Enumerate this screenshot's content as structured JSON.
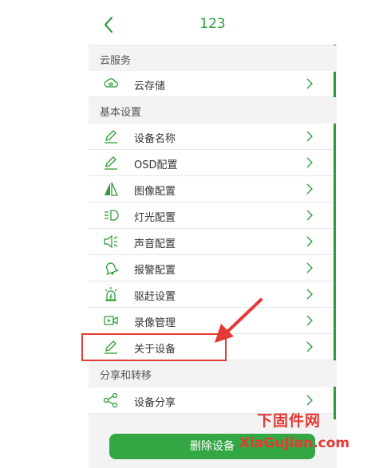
{
  "header": {
    "title": "123"
  },
  "sections": [
    {
      "title": "云服务",
      "items": [
        {
          "label": "云存储",
          "icon": "cloud-storage-icon"
        }
      ]
    },
    {
      "title": "基本设置",
      "items": [
        {
          "label": "设备名称",
          "icon": "pencil-icon"
        },
        {
          "label": "OSD配置",
          "icon": "pencil-icon"
        },
        {
          "label": "图像配置",
          "icon": "image-triangle-icon"
        },
        {
          "label": "灯光配置",
          "icon": "light-icon"
        },
        {
          "label": "声音配置",
          "icon": "speaker-icon"
        },
        {
          "label": "报警配置",
          "icon": "bell-icon"
        },
        {
          "label": "驱赶设置",
          "icon": "alarm-light-icon"
        },
        {
          "label": "录像管理",
          "icon": "video-icon"
        },
        {
          "label": "关于设备",
          "icon": "pencil-icon"
        }
      ]
    },
    {
      "title": "分享和转移",
      "items": [
        {
          "label": "设备分享",
          "icon": "share-icon"
        }
      ]
    }
  ],
  "delete_button": {
    "label": "删除设备"
  },
  "watermark": {
    "line1": "下固件网",
    "line2": "XiaGuJian.com"
  },
  "colors": {
    "accent": "#2e9d3a",
    "highlight": "#e53935"
  }
}
